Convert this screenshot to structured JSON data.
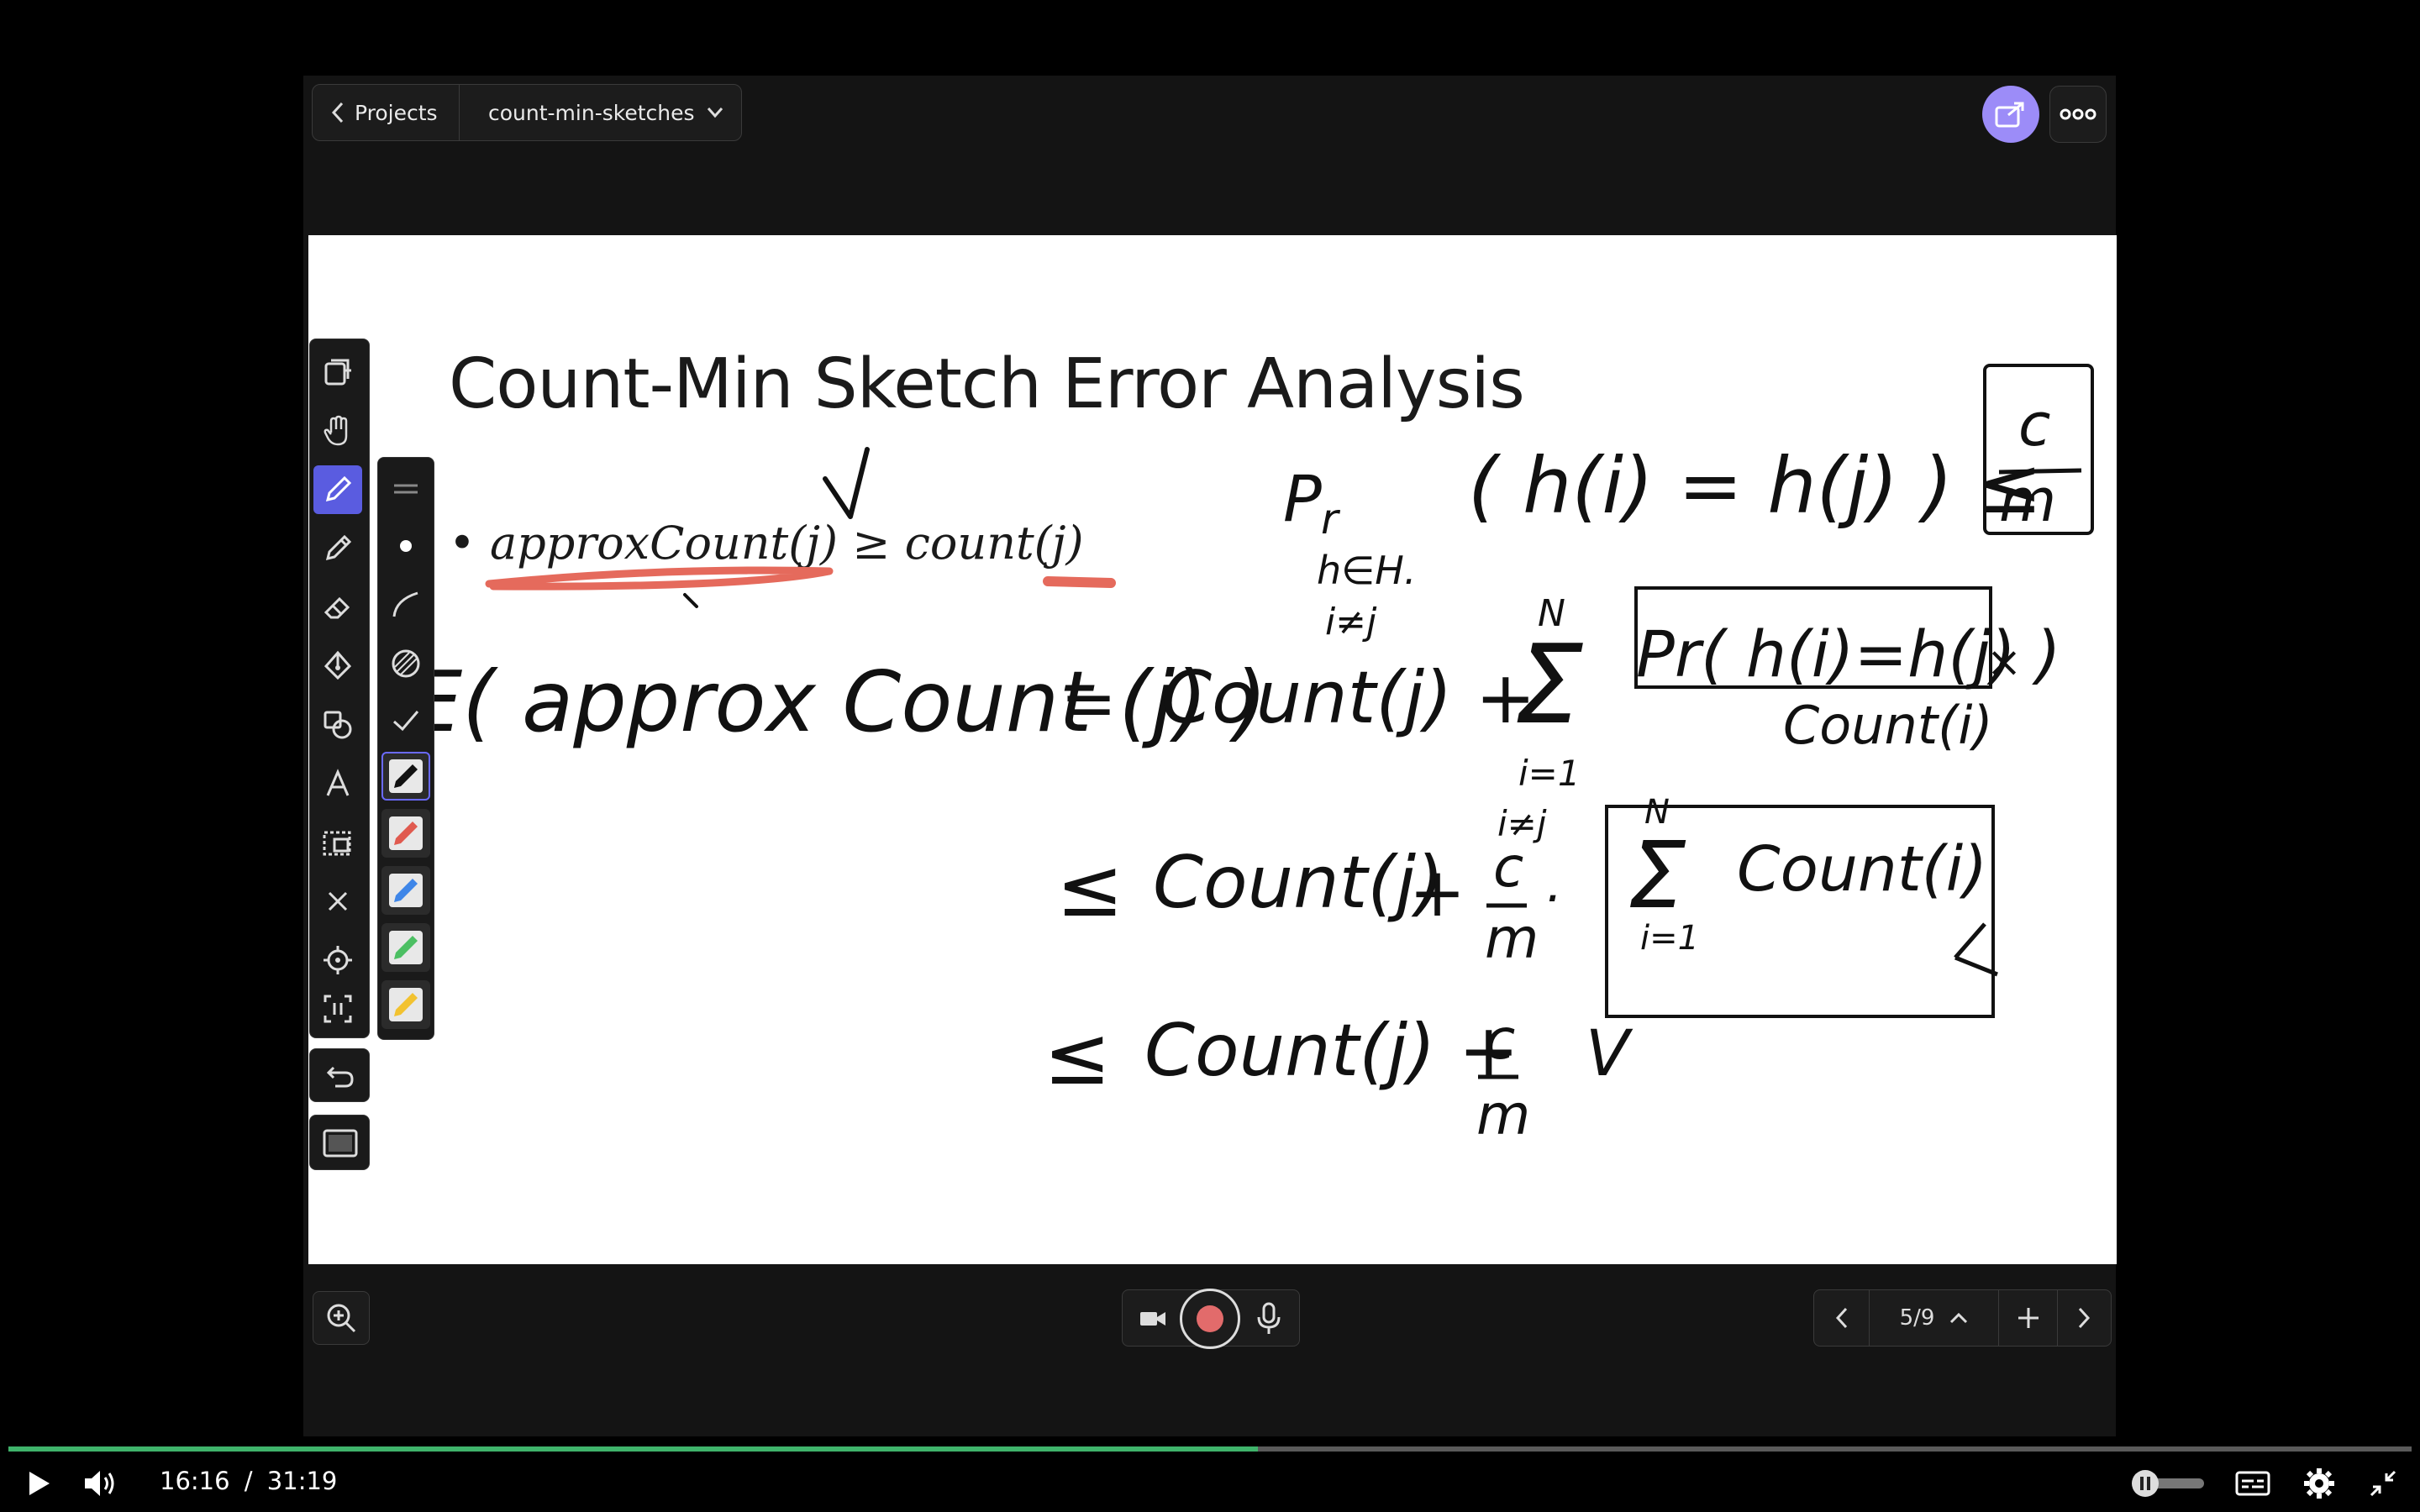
{
  "header": {
    "back_label": "Projects",
    "project_name": "count-min-sketches"
  },
  "slide": {
    "title": "Count-Min Sketch Error Analysis",
    "bullet": "• approxCount(j) ≥ count(j)"
  },
  "handwriting": {
    "pr_line": "Pr (h(i)=h(j)) ≤ c/m",
    "expectation_line": "E(approxCount(j)) = Count(j) + Σ Pr(h(i)=h(j)) × Count(i)",
    "bound_line_1": "≤ Count(j) + c/m · Σ Count(i)",
    "bound_line_2": "≤ Count(j) + c/m V"
  },
  "toolbar": {
    "tools": [
      "copy-tool-icon",
      "hand-tool-icon",
      "pen-tool-icon",
      "highlighter-tool-icon",
      "eraser-tool-icon",
      "fill-tool-icon",
      "shapes-tool-icon",
      "text-tool-icon",
      "lasso-tool-icon",
      "clear-tool-icon",
      "laser-tool-icon",
      "capture-tool-icon"
    ],
    "active_tool": "pen-tool-icon",
    "pen_colors": [
      "#111111",
      "#e05a4f",
      "#3f86e8",
      "#4cbf63",
      "#f2c230"
    ],
    "accent": "#5a5ce0"
  },
  "pager": {
    "page_indicator": "5/9"
  },
  "player": {
    "current_time": "16:16",
    "separator": "/",
    "duration": "31:19",
    "progress": 0.52,
    "progress_color": "#3fb36b"
  }
}
